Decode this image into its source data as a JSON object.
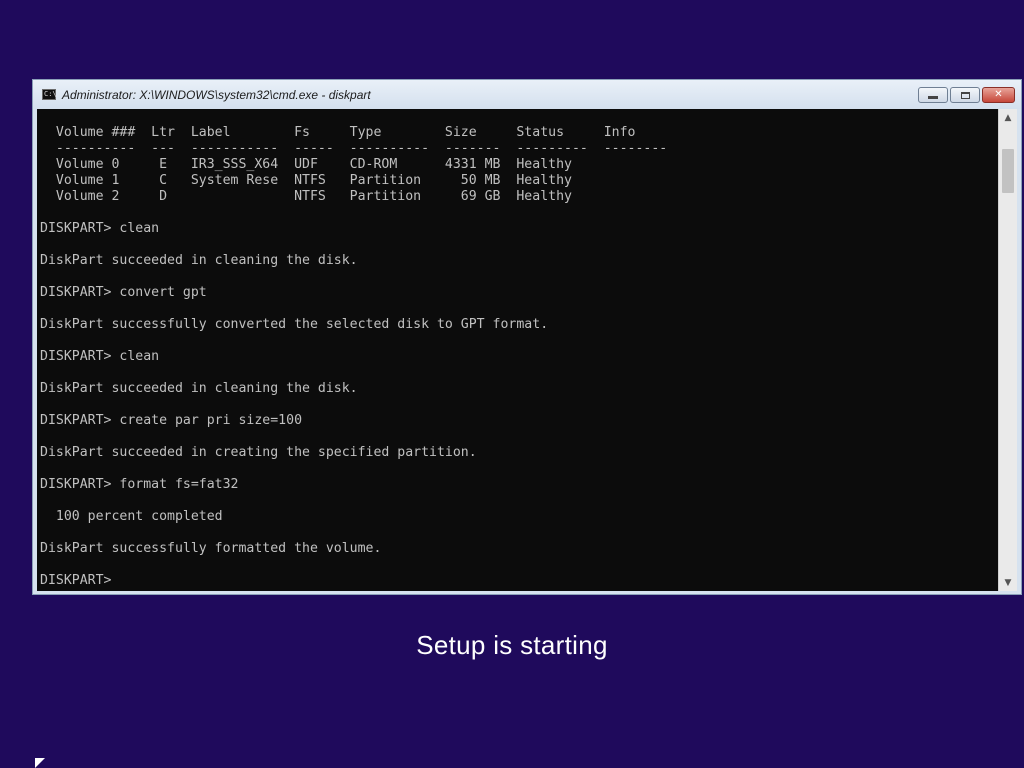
{
  "window": {
    "title": "Administrator: X:\\WINDOWS\\system32\\cmd.exe - diskpart",
    "icon": "cmd-icon",
    "controls": {
      "minimize": "minimize-icon",
      "maximize": "maximize-icon",
      "close": "close-icon",
      "close_label": "✕"
    }
  },
  "console": {
    "lines": [
      "",
      "  Volume ###  Ltr  Label        Fs     Type        Size     Status     Info",
      "  ----------  ---  -----------  -----  ----------  -------  ---------  --------",
      "  Volume 0     E   IR3_SSS_X64  UDF    CD-ROM      4331 MB  Healthy",
      "  Volume 1     C   System Rese  NTFS   Partition     50 MB  Healthy",
      "  Volume 2     D                NTFS   Partition     69 GB  Healthy",
      "",
      "DISKPART> clean",
      "",
      "DiskPart succeeded in cleaning the disk.",
      "",
      "DISKPART> convert gpt",
      "",
      "DiskPart successfully converted the selected disk to GPT format.",
      "",
      "DISKPART> clean",
      "",
      "DiskPart succeeded in cleaning the disk.",
      "",
      "DISKPART> create par pri size=100",
      "",
      "DiskPart succeeded in creating the specified partition.",
      "",
      "DISKPART> format fs=fat32",
      "",
      "  100 percent completed",
      "",
      "DiskPart successfully formatted the volume.",
      "",
      "DISKPART>"
    ]
  },
  "scrollbar": {
    "up_icon": "scroll-up-arrow-icon",
    "down_icon": "scroll-down-arrow-icon"
  },
  "setup": {
    "status_text": "Setup is starting"
  },
  "colors": {
    "background": "#1f0a5c",
    "console_bg": "#0c0c0c",
    "console_text": "#c0c0c0"
  }
}
